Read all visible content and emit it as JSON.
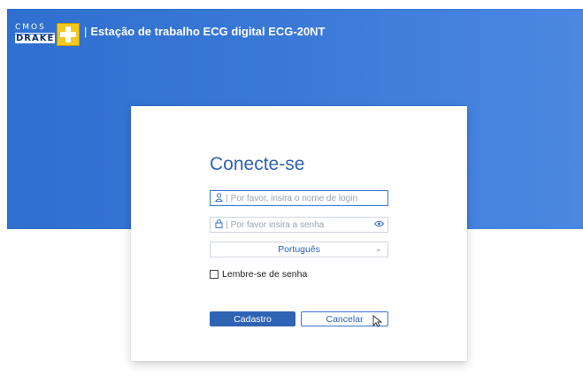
{
  "header": {
    "logo": {
      "top_text": "CMOS",
      "bottom_text": "DRAKE"
    },
    "separator": "|",
    "title": "Estação de trabalho ECG digital ECG-20NT",
    "bg_color": "#2f6fcf"
  },
  "login": {
    "heading": "Conecte-se",
    "username": {
      "icon": "user-icon",
      "placeholder": "Por favor, insira o nome de login",
      "value": ""
    },
    "password": {
      "icon": "lock-icon",
      "placeholder": "Por favor insira a senha",
      "value": "",
      "reveal_icon": "eye-icon"
    },
    "language": {
      "selected": "Português",
      "icon": "chevron-down-icon"
    },
    "remember": {
      "label": "Lembre-se de senha",
      "checked": false
    },
    "buttons": {
      "submit": "Cadastro",
      "cancel": "Cancelar"
    },
    "accent_color": "#2f63b4"
  }
}
